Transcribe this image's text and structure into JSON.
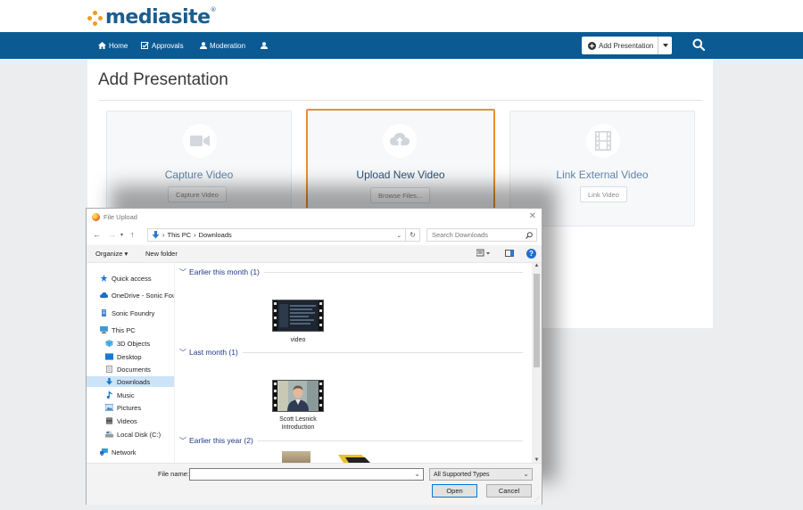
{
  "app": {
    "logo_text": "mediasite",
    "logo_mark": "®"
  },
  "nav": {
    "home": "Home",
    "approvals": "Approvals",
    "moderation": "Moderation",
    "add_presentation": "Add Presentation"
  },
  "page": {
    "title": "Add Presentation",
    "cards": [
      {
        "title": "Capture Video",
        "button": "Capture Video"
      },
      {
        "title": "Upload New Video",
        "button": "Browse Files..."
      },
      {
        "title": "Link External Video",
        "button": "Link Video"
      }
    ]
  },
  "dialog": {
    "title": "File Upload",
    "breadcrumb": [
      "This PC",
      "Downloads"
    ],
    "search_placeholder": "Search Downloads",
    "toolbar": {
      "organize": "Organize ▾",
      "new_folder": "New folder"
    },
    "help": "?",
    "tree": [
      {
        "label": "Quick access",
        "icon": "star-icon"
      },
      {
        "label": "OneDrive - Sonic Foundry",
        "icon": "cloud-icon"
      },
      {
        "label": "Sonic Foundry",
        "icon": "building-icon"
      },
      {
        "label": "This PC",
        "icon": "computer-icon"
      },
      {
        "label": "3D Objects",
        "icon": "cube-icon"
      },
      {
        "label": "Desktop",
        "icon": "desktop-icon"
      },
      {
        "label": "Documents",
        "icon": "document-icon"
      },
      {
        "label": "Downloads",
        "icon": "download-icon"
      },
      {
        "label": "Music",
        "icon": "music-icon"
      },
      {
        "label": "Pictures",
        "icon": "pictures-icon"
      },
      {
        "label": "Videos",
        "icon": "video-icon"
      },
      {
        "label": "Local Disk (C:)",
        "icon": "disk-icon"
      },
      {
        "label": "Network",
        "icon": "network-icon"
      }
    ],
    "groups": [
      {
        "label": "Earlier this month (1)"
      },
      {
        "label": "Last month (1)"
      },
      {
        "label": "Earlier this year (2)"
      }
    ],
    "files": [
      {
        "label": "video"
      },
      {
        "label": "Scott Lesnick Introduction"
      }
    ],
    "file_name_label": "File name:",
    "file_name_value": "",
    "file_type": "All Supported Types",
    "open": "Open",
    "cancel": "Cancel"
  },
  "colors": {
    "nav_bg": "#0b5a93",
    "accent": "#e8912c",
    "logo_blue": "#1c5d8c",
    "logo_orange": "#f39a1f"
  }
}
